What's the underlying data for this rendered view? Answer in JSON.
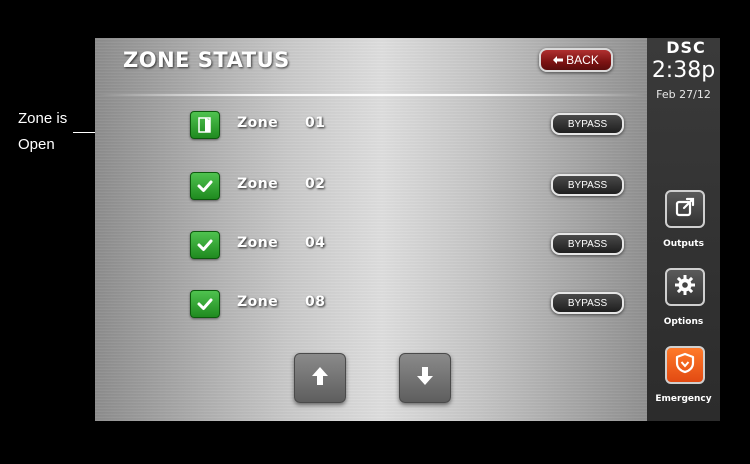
{
  "header": {
    "title": "ZONE STATUS",
    "back_label": "BACK"
  },
  "zones": [
    {
      "label": "Zone",
      "number": "01",
      "status": "open",
      "icon": "door-open-icon",
      "bypass_label": "BYPASS"
    },
    {
      "label": "Zone",
      "number": "02",
      "status": "closed",
      "icon": "checkmark-icon",
      "bypass_label": "BYPASS"
    },
    {
      "label": "Zone",
      "number": "04",
      "status": "closed",
      "icon": "checkmark-icon",
      "bypass_label": "BYPASS"
    },
    {
      "label": "Zone",
      "number": "08",
      "status": "closed",
      "icon": "checkmark-icon",
      "bypass_label": "BYPASS"
    }
  ],
  "scroll": {
    "up_icon": "arrow-up-icon",
    "down_icon": "arrow-down-icon"
  },
  "sidebar": {
    "brand": "DSC",
    "time": "2:38p",
    "date": "Feb 27/12",
    "outputs_label": "Outputs",
    "options_label": "Options",
    "emergency_label": "Emergency"
  },
  "callout": {
    "line1": "Zone is",
    "line2": "Open"
  },
  "colors": {
    "zone_green": "#2a9a2a",
    "back_red": "#8b1a1a",
    "emergency_orange": "#f05a1e",
    "panel_dark": "#333333"
  }
}
